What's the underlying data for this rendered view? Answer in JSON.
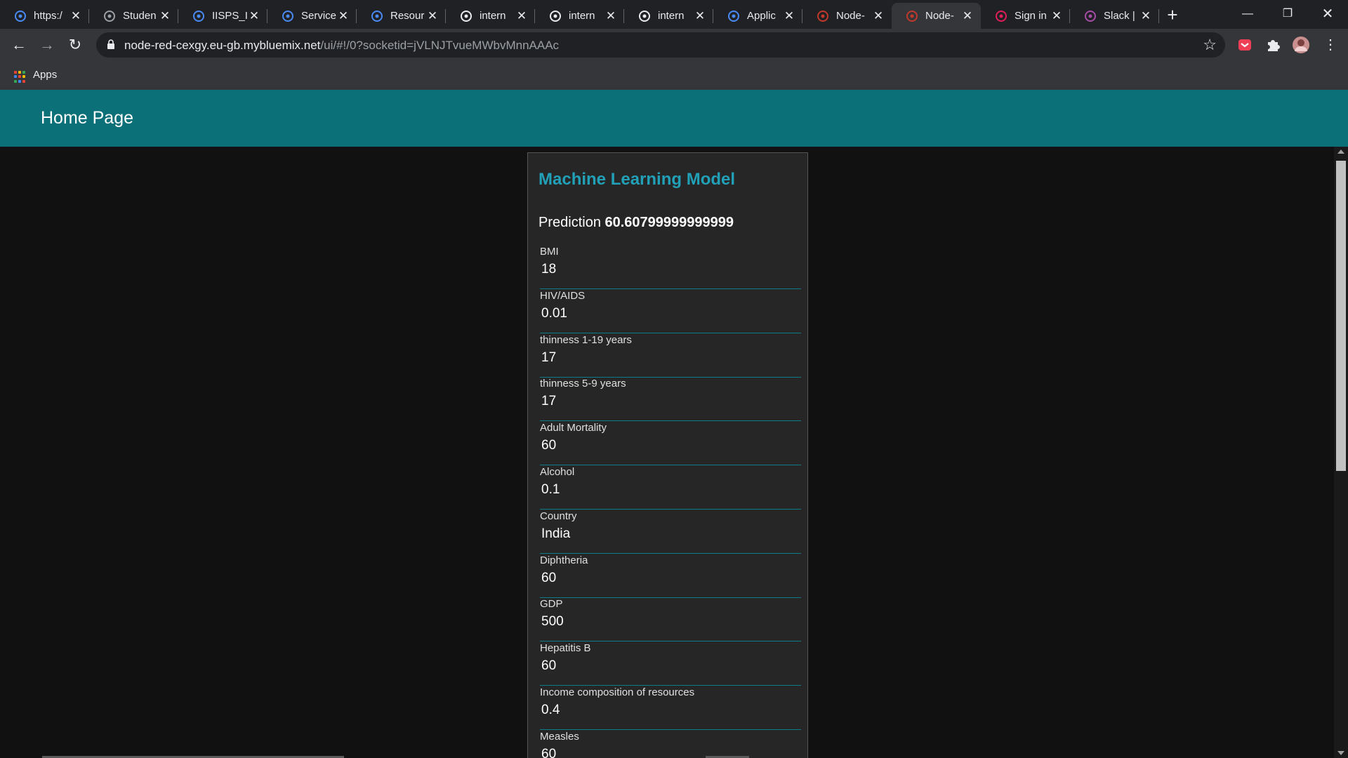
{
  "browser": {
    "tabs": [
      {
        "title": "https:/",
        "icon": "globe-shield-icon",
        "color": "#4a8af4"
      },
      {
        "title": "Studen",
        "icon": "globe-icon",
        "color": "#9aa0a6"
      },
      {
        "title": "IISPS_I",
        "icon": "doc-icon",
        "color": "#4a8af4"
      },
      {
        "title": "Service",
        "icon": "ibm-cloud-icon",
        "color": "#4a8af4"
      },
      {
        "title": "Resour",
        "icon": "ibm-cloud-icon",
        "color": "#4a8af4"
      },
      {
        "title": "intern",
        "icon": "github-icon",
        "color": "#e8eaed"
      },
      {
        "title": "intern",
        "icon": "github-icon",
        "color": "#e8eaed"
      },
      {
        "title": "intern",
        "icon": "github-icon",
        "color": "#e8eaed"
      },
      {
        "title": "Applic",
        "icon": "ibm-cloud-icon",
        "color": "#4a8af4"
      },
      {
        "title": "Node-",
        "icon": "node-red-icon",
        "color": "#c0392b"
      },
      {
        "title": "Node-",
        "icon": "node-red-icon",
        "color": "#c0392b"
      },
      {
        "title": "Sign in",
        "icon": "slack-icon",
        "color": "#e01e5a"
      },
      {
        "title": "Slack |",
        "icon": "slack-icon",
        "color": "#a64ca6"
      }
    ],
    "active_tab": 10,
    "url_host": "node-red-cexgy.eu-gb.mybluemix.net",
    "url_path": "/ui/#!/0?socketid=jVLNJTvueMWbvMnnAAAc",
    "bookmarks_apps_label": "Apps"
  },
  "header": {
    "title": "Home Page"
  },
  "card": {
    "title": "Machine Learning Model",
    "prediction_label": "Prediction",
    "prediction_value": "60.60799999999999",
    "fields": [
      {
        "label": "BMI",
        "value": "18"
      },
      {
        "label": "HIV/AIDS",
        "value": "0.01"
      },
      {
        "label": "thinness 1-19 years",
        "value": "17"
      },
      {
        "label": "thinness 5-9 years",
        "value": "17"
      },
      {
        "label": "Adult Mortality",
        "value": "60"
      },
      {
        "label": "Alcohol",
        "value": "0.1"
      },
      {
        "label": "Country",
        "value": "India"
      },
      {
        "label": "Diphtheria",
        "value": "60"
      },
      {
        "label": "GDP",
        "value": "500"
      },
      {
        "label": "Hepatitis B",
        "value": "60"
      },
      {
        "label": "Income composition of resources",
        "value": "0.4"
      },
      {
        "label": "Measles",
        "value": "60"
      }
    ]
  },
  "colors": {
    "header_bg": "#0c7079",
    "accent": "#21a0b8",
    "field_underline": "#0e7c86",
    "card_bg": "#262626",
    "page_bg": "#111111"
  }
}
